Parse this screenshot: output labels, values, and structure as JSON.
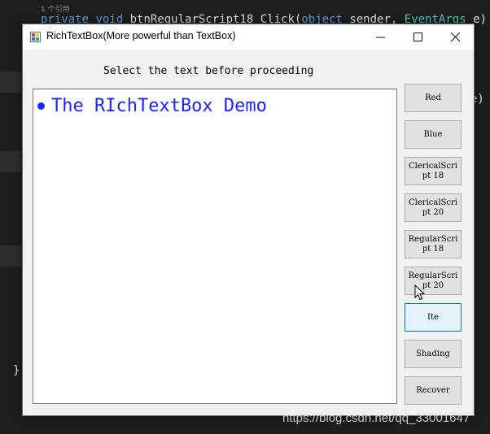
{
  "editor": {
    "ref_hint": "1 个引用",
    "code_tokens": [
      {
        "text": "private ",
        "kind": "kw"
      },
      {
        "text": "void ",
        "kind": "kw"
      },
      {
        "text": "btnRegularScript18_Click(",
        "kind": "plain"
      },
      {
        "text": "object ",
        "kind": "kw"
      },
      {
        "text": "sender, ",
        "kind": "plain"
      },
      {
        "text": "EventArgs ",
        "kind": "ty"
      },
      {
        "text": "e)",
        "kind": "plain"
      }
    ],
    "side_fragment": "e)",
    "closing_brace": "}"
  },
  "watermark": "https://blog.csdn.net/qq_33001647",
  "window": {
    "title": "RichTextBox(More powerful than TextBox)",
    "minimize_glyph": "—",
    "maximize_glyph": "☐",
    "close_glyph": "✕",
    "instruction": "Select the text before proceeding",
    "richtext": {
      "bullet": true,
      "text": "The RIchTextBox Demo",
      "color": "#1a23ff"
    },
    "buttons": [
      {
        "label": "Red"
      },
      {
        "label": "Blue"
      },
      {
        "label": "ClericalScript 18"
      },
      {
        "label": "ClericalScript 20"
      },
      {
        "label": "RegularScript 18"
      },
      {
        "label": "RegularScript 20"
      },
      {
        "label": "Italic",
        "visible_label": "Ite",
        "focused": true
      },
      {
        "label": "Shading"
      },
      {
        "label": "Recover"
      }
    ]
  }
}
